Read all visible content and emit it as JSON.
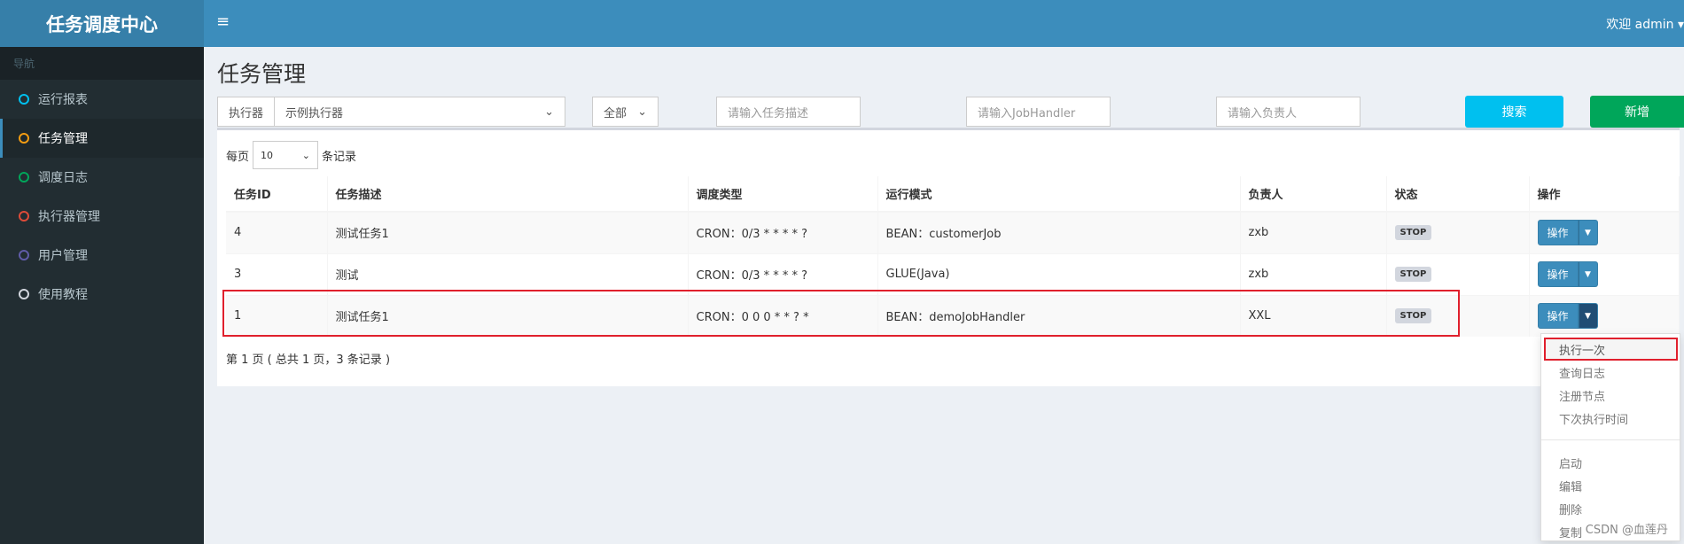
{
  "app": {
    "logo": "任务调度中心"
  },
  "topbar": {
    "welcome": "欢迎 admin ▾",
    "menu_icon": "hamburger-icon"
  },
  "sidebar": {
    "header": "导航",
    "items": [
      {
        "label": "运行报表",
        "color": "#00c0ef"
      },
      {
        "label": "任务管理",
        "color": "#f39c12"
      },
      {
        "label": "调度日志",
        "color": "#00a65a"
      },
      {
        "label": "执行器管理",
        "color": "#dd4b39"
      },
      {
        "label": "用户管理",
        "color": "#605ca8"
      },
      {
        "label": "使用教程",
        "color": "#d2d6de"
      }
    ]
  },
  "page": {
    "title": "任务管理"
  },
  "filters": {
    "executor_label": "执行器",
    "executor_value": "示例执行器",
    "status_value": "全部",
    "desc_placeholder": "请输入任务描述",
    "handler_placeholder": "请输入JobHandler",
    "author_placeholder": "请输入负责人",
    "search": "搜索",
    "add": "新增"
  },
  "table": {
    "length_prefix": "每页",
    "length_value": "10",
    "length_suffix": "条记录",
    "headers": [
      "任务ID",
      "任务描述",
      "调度类型",
      "运行模式",
      "负责人",
      "状态",
      "操作"
    ],
    "rows": [
      {
        "id": "4",
        "desc": "测试任务1",
        "schedule": "CRON：0/3 * * * * ?",
        "mode": "BEAN：customerJob",
        "author": "zxb",
        "status": "STOP",
        "op": "操作"
      },
      {
        "id": "3",
        "desc": "测试",
        "schedule": "CRON：0/3 * * * * ?",
        "mode": "GLUE(Java)",
        "author": "zxb",
        "status": "STOP",
        "op": "操作"
      },
      {
        "id": "1",
        "desc": "测试任务1",
        "schedule": "CRON：0 0 0 * * ? *",
        "mode": "BEAN：demoJobHandler",
        "author": "XXL",
        "status": "STOP",
        "op": "操作"
      }
    ],
    "info": "第 1 页 ( 总共 1 页，3 条记录 )"
  },
  "dropdown": {
    "group1": [
      "执行一次",
      "查询日志",
      "注册节点",
      "下次执行时间"
    ],
    "group2": [
      "启动",
      "编辑",
      "删除",
      "复制"
    ]
  },
  "watermark": "CSDN @血莲丹",
  "colors": {
    "primary": "#3c8dbc",
    "search": "#00c0ef",
    "add": "#00a65a",
    "highlight": "#e0202d"
  }
}
